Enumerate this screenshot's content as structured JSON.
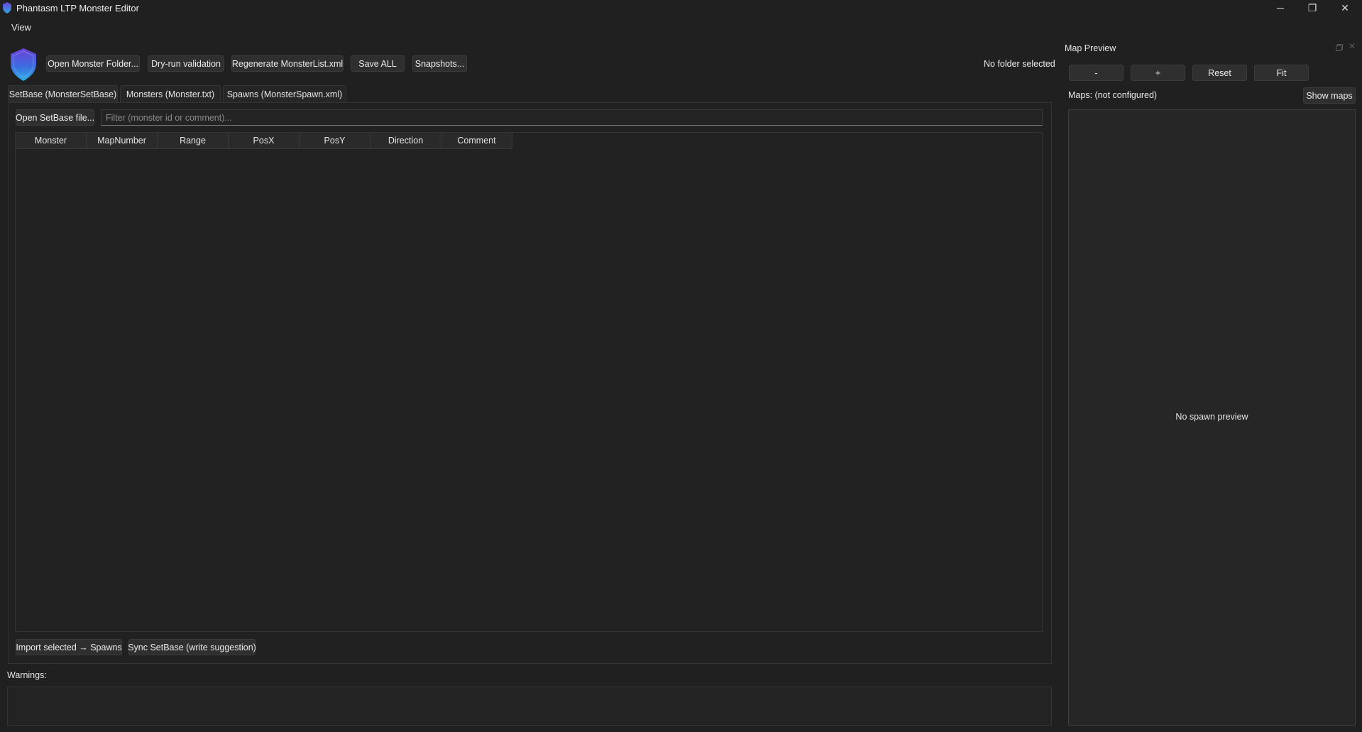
{
  "window": {
    "title": "Phantasm LTP Monster Editor",
    "minimize_glyph": "─",
    "maximize_glyph": "❐",
    "close_glyph": "✕"
  },
  "menu": {
    "items": [
      {
        "label": "View"
      }
    ]
  },
  "toolbar": {
    "logo_icon": "shield-logo-icon",
    "open_folder": "Open Monster Folder...",
    "dry_run": "Dry-run validation",
    "regenerate": "Regenerate MonsterList.xml",
    "save_all": "Save ALL",
    "snapshots": "Snapshots...",
    "folder_status": "No folder selected"
  },
  "tabs": [
    {
      "label": "SetBase (MonsterSetBase)",
      "active": true
    },
    {
      "label": "Monsters (Monster.txt)",
      "active": false
    },
    {
      "label": "Spawns (MonsterSpawn.xml)",
      "active": false
    }
  ],
  "setbase": {
    "open_file": "Open SetBase file...",
    "filter_placeholder": "Filter (monster id or comment)...",
    "columns": [
      "Monster",
      "MapNumber",
      "Range",
      "PosX",
      "PosY",
      "Direction",
      "Comment"
    ],
    "rows": [],
    "import_selected": "Import selected → Spawns",
    "sync_setbase": "Sync SetBase (write suggestion)"
  },
  "warnings": {
    "label": "Warnings:",
    "text": ""
  },
  "map_preview": {
    "title": "Map Preview",
    "zoom_out": "-",
    "zoom_in": "+",
    "reset": "Reset",
    "fit": "Fit",
    "maps_label": "Maps: (not configured)",
    "show_maps": "Show maps",
    "empty_text": "No spawn preview",
    "float_icon": "float-icon",
    "close_glyph": "✕"
  },
  "colors": {
    "background": "#202020",
    "panel": "#212121",
    "button": "#2f2f2f",
    "logo_top": "#6a3fd9",
    "logo_bottom": "#2fa8e0"
  }
}
